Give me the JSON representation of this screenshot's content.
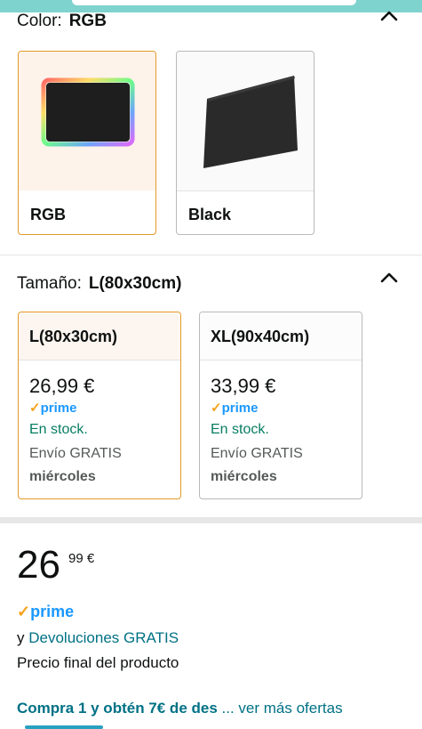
{
  "color": {
    "label": "Color:",
    "value": "RGB",
    "options": [
      {
        "name": "RGB",
        "selected": true
      },
      {
        "name": "Black",
        "selected": false
      }
    ]
  },
  "size": {
    "label": "Tamaño:",
    "value": "L(80x30cm)",
    "options": [
      {
        "name": "L(80x30cm)",
        "price": "26,99 €",
        "prime": "prime",
        "stock": "En stock.",
        "shipping": "Envío GRATIS",
        "day": "miércoles",
        "selected": true
      },
      {
        "name": "XL(90x40cm)",
        "price": "33,99 €",
        "prime": "prime",
        "stock": "En stock.",
        "shipping": "Envío GRATIS",
        "day": "miércoles",
        "selected": false
      }
    ]
  },
  "price": {
    "whole": "26",
    "fraction": "99 €",
    "prime": "prime",
    "returns_prefix": "y",
    "returns_link": "Devoluciones GRATIS",
    "final_note": "Precio final del producto"
  },
  "promo": {
    "text": "Compra 1 y obtén 7€ de des",
    "more": "... ver más ofertas"
  },
  "colors": {
    "accent_selected": "#e49a28",
    "link": "#007185",
    "prime_blue": "#1a98ff",
    "stock_green": "#067d62"
  },
  "icons": [
    "chevron-up-icon",
    "prime-check-icon"
  ]
}
